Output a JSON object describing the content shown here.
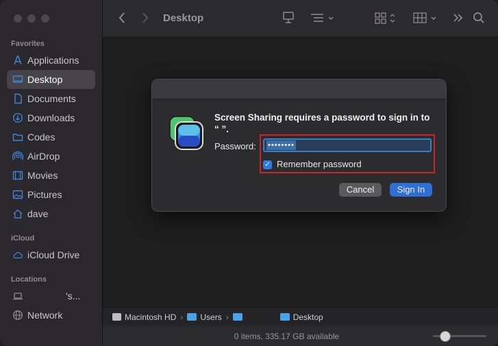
{
  "window": {
    "title": "Desktop"
  },
  "sidebar": {
    "favorites_title": "Favorites",
    "favorites": [
      {
        "label": "Applications",
        "icon": "applications-icon"
      },
      {
        "label": "Desktop",
        "icon": "desktop-icon",
        "selected": true
      },
      {
        "label": "Documents",
        "icon": "document-icon"
      },
      {
        "label": "Downloads",
        "icon": "download-icon"
      },
      {
        "label": "Codes",
        "icon": "folder-icon"
      },
      {
        "label": "AirDrop",
        "icon": "airdrop-icon"
      },
      {
        "label": "Movies",
        "icon": "movies-icon"
      },
      {
        "label": "Pictures",
        "icon": "pictures-icon"
      },
      {
        "label": "dave",
        "icon": "home-icon"
      }
    ],
    "icloud_title": "iCloud",
    "icloud": [
      {
        "label": "iCloud Drive",
        "icon": "cloud-icon"
      }
    ],
    "locations_title": "Locations",
    "locations": [
      {
        "label": "'s...",
        "icon": "laptop-icon"
      },
      {
        "label": "Network",
        "icon": "network-icon"
      }
    ]
  },
  "pathbar": {
    "items": [
      "Macintosh HD",
      "Users",
      "",
      "Desktop"
    ]
  },
  "status": {
    "text": "0 items, 335.17 GB available"
  },
  "dialog": {
    "message_line1": "Screen Sharing requires a password to sign in to",
    "message_line2": "“                       ”.",
    "password_label": "Password:",
    "password_value": "••••••••",
    "remember_label": "Remember password",
    "remember_checked": true,
    "cancel_label": "Cancel",
    "signin_label": "Sign In"
  },
  "colors": {
    "accent": "#2d6fd6",
    "highlight_box": "#c8262a",
    "folder": "#4aa3e8"
  }
}
